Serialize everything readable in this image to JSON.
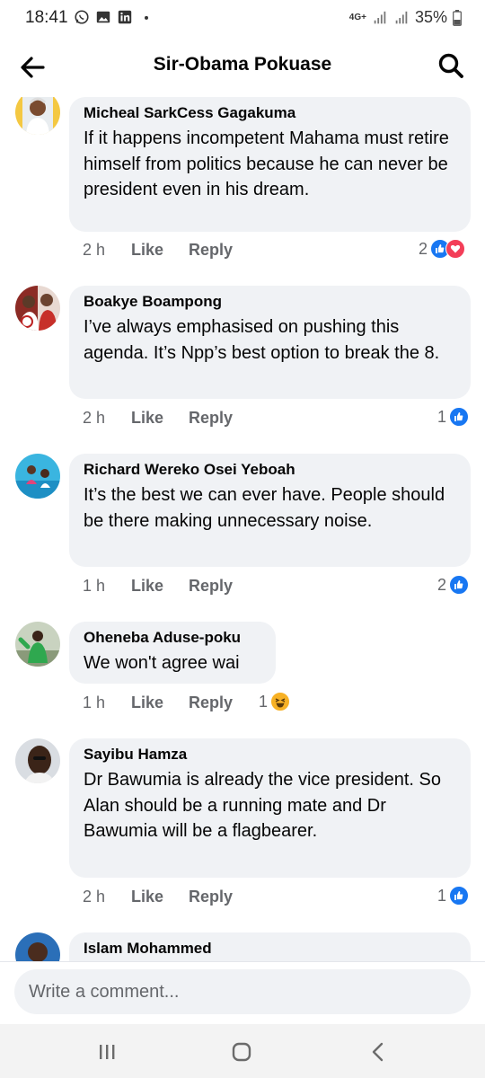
{
  "status_bar": {
    "time": "18:41",
    "network": "4G+",
    "battery": "35%"
  },
  "header": {
    "title": "Sir-Obama Pokuase"
  },
  "colors": {
    "bubble": "#f0f2f5",
    "like_blue": "#1877f2",
    "love_red": "#f33e58",
    "haha_yellow": "#f7b125",
    "meta_gray": "#65676b"
  },
  "comments": [
    {
      "author": "Micheal SarkCess Gagakuma",
      "text": "If it happens incompetent Mahama must retire himself from politics because he can never be president even in his dream.",
      "time": "2 h",
      "like_label": "Like",
      "reply_label": "Reply",
      "reaction_count": "2",
      "reactions": [
        "like",
        "love"
      ]
    },
    {
      "author": "Boakye Boampong",
      "text": "I’ve always emphasised on pushing this agenda. It’s Npp’s best option to break the 8.",
      "time": "2 h",
      "like_label": "Like",
      "reply_label": "Reply",
      "reaction_count": "1",
      "reactions": [
        "like"
      ]
    },
    {
      "author": "Richard Wereko Osei Yeboah",
      "text": "It’s the best we can ever have. People should be there making unnecessary noise.",
      "time": "1 h",
      "like_label": "Like",
      "reply_label": "Reply",
      "reaction_count": "2",
      "reactions": [
        "like"
      ]
    },
    {
      "author": "Oheneba Aduse-poku",
      "text": "We won't agree wai",
      "time": "1 h",
      "like_label": "Like",
      "reply_label": "Reply",
      "reaction_count": "1",
      "reactions": [
        "haha"
      ]
    },
    {
      "author": "Sayibu Hamza",
      "text": "Dr Bawumia is already the vice president. So Alan should be a running mate and Dr Bawumia will be a flagbearer.",
      "time": "2 h",
      "like_label": "Like",
      "reply_label": "Reply",
      "reaction_count": "1",
      "reactions": [
        "like"
      ]
    },
    {
      "author": "Islam Mohammed"
    }
  ],
  "composer": {
    "placeholder": "Write a comment..."
  }
}
